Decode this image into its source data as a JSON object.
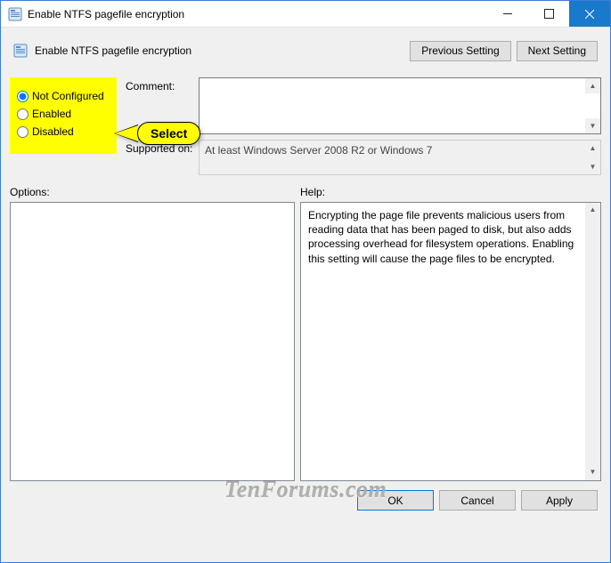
{
  "window": {
    "title": "Enable NTFS pagefile encryption"
  },
  "header": {
    "policy_title": "Enable NTFS pagefile encryption",
    "previous_button": "Previous Setting",
    "next_button": "Next Setting"
  },
  "radios": {
    "not_configured": "Not Configured",
    "enabled": "Enabled",
    "disabled": "Disabled",
    "selected": "not_configured"
  },
  "callout": {
    "text": "Select"
  },
  "fields": {
    "comment_label": "Comment:",
    "comment_value": "",
    "supported_label": "Supported on:",
    "supported_value": "At least Windows Server 2008 R2 or Windows 7"
  },
  "sections": {
    "options_label": "Options:",
    "help_label": "Help:",
    "help_text": "Encrypting the page file prevents malicious users from reading data that has been paged to disk, but also adds processing overhead for filesystem operations.  Enabling this setting will cause the page files to be encrypted."
  },
  "buttons": {
    "ok": "OK",
    "cancel": "Cancel",
    "apply": "Apply"
  },
  "watermark": "TenForums.com"
}
